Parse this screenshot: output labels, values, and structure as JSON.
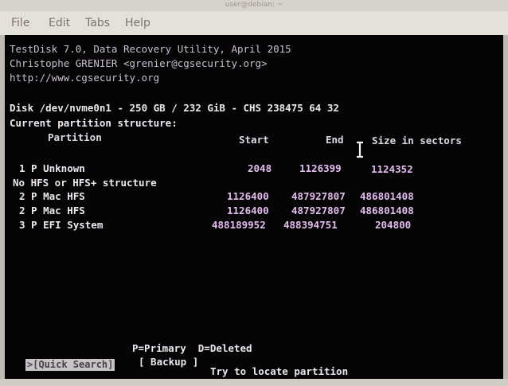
{
  "window": {
    "title": "user@debian: ~"
  },
  "menubar": {
    "items": [
      "File",
      "Edit",
      "Tabs",
      "Help"
    ]
  },
  "terminal": {
    "header": [
      "TestDisk 7.0, Data Recovery Utility, April 2015",
      "Christophe GRENIER <grenier@cgsecurity.org>",
      "http://www.cgsecurity.org"
    ],
    "disk_line": "Disk /dev/nvme0n1 - 250 GB / 232 GiB - CHS 238475 64 32",
    "structure_title": "Current partition structure:",
    "columns": {
      "partition": "Partition",
      "start": "Start",
      "end": "End",
      "size": "Size in sectors"
    },
    "rows": [
      {
        "label": "1 P Unknown",
        "start": "2048",
        "end": "1126399",
        "size": "1124352"
      },
      {
        "label": "No HFS or HFS+ structure",
        "start": "",
        "end": "",
        "size": ""
      },
      {
        "label": "2 P Mac HFS",
        "start": "1126400",
        "end": "487927807",
        "size": "486801408"
      },
      {
        "label": "2 P Mac HFS",
        "start": "1126400",
        "end": "487927807",
        "size": "486801408"
      },
      {
        "label": "3 P EFI System",
        "start": "488189952",
        "end": "488394751",
        "size": "204800"
      }
    ],
    "legend": "P=Primary  D=Deleted",
    "actions": {
      "quick_search": ">[Quick Search]",
      "backup": "[ Backup ]"
    },
    "hint": "Try to locate partition"
  }
}
